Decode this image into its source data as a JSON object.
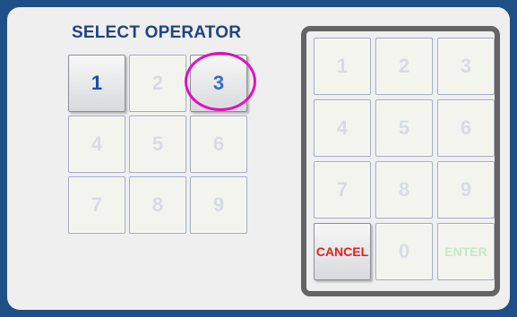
{
  "operator_select": {
    "title": "SELECT OPERATOR",
    "keys": [
      "1",
      "2",
      "3",
      "4",
      "5",
      "6",
      "7",
      "8",
      "9"
    ]
  },
  "keypad": {
    "keys": [
      "1",
      "2",
      "3",
      "4",
      "5",
      "6",
      "7",
      "8",
      "9"
    ],
    "cancel_label": "CANCEL",
    "zero_label": "0",
    "enter_label": "ENTER"
  },
  "colors": {
    "frame": "#1f4f87",
    "title": "#1f4386",
    "active_digit": "#1e4ea6",
    "cancel": "#e2231a",
    "enter_disabled": "#c6e8c4",
    "highlight_ring": "#e40ec4"
  }
}
